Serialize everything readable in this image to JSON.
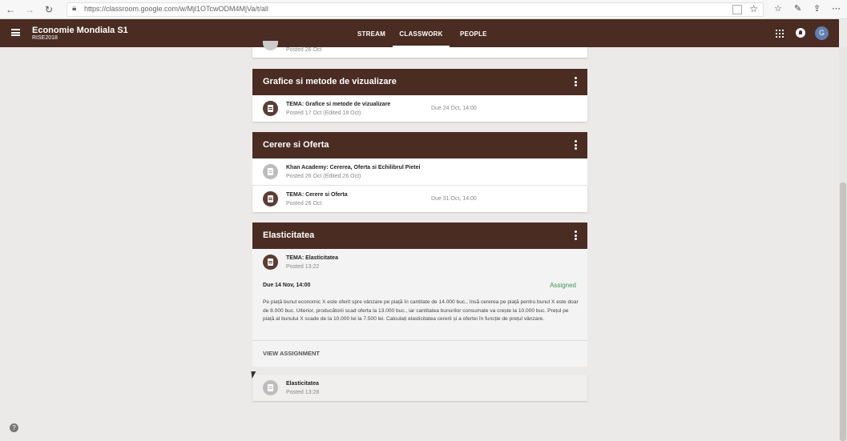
{
  "browser": {
    "url": "https://classroom.google.com/w/Mjl1OTcwODM4MjVa/t/all"
  },
  "app": {
    "class_title": "Economie Mondiala S1",
    "class_subtitle": "RISE2018",
    "tabs": [
      {
        "label": "STREAM"
      },
      {
        "label": "CLASSWORK"
      },
      {
        "label": "PEOPLE"
      }
    ],
    "avatar_letter": "G",
    "accent_color": "#4a2c23"
  },
  "top_partial": {
    "posted": "Posted 26 Oct"
  },
  "topics": [
    {
      "title": "Grafice si metode de vizualizare",
      "items": [
        {
          "title": "TEMA: Grafice si metode de vizualizare",
          "posted": "Posted 17 Oct (Edited 18 Oct)",
          "due": "Due 24 Oct, 14:00"
        }
      ]
    },
    {
      "title": "Cerere si Oferta",
      "items": [
        {
          "title": "Khan Academy: Cererea, Oferta si Echilibrul Pietei",
          "posted": "Posted 26 Oct (Edited 26 Oct)",
          "due": ""
        },
        {
          "title": "TEMA: Cerere si Oferta",
          "posted": "Posted 26 Oct",
          "due": "Due 31 Oct, 14:00"
        }
      ]
    },
    {
      "title": "Elasticitatea",
      "items": [
        {
          "title": "TEMA: Elasticitatea",
          "posted": "Posted 13:22",
          "due": ""
        }
      ],
      "expanded": {
        "due": "Due 14 Nov, 14:00",
        "status": "Assigned",
        "description": "Pe piață bunul economic X este oferit spre vânzare pe piață în cantitate de 14.000 buc., însă cererea pe piață pentru bunul X este doar de 8.000 buc. Ulterior, producătorii scad oferta la 13.000 buc., iar cantitatea bunurilor consumate va crește la 10.000 buc. Prețul pe piață al bunului X scade de la 10.000 lei la 7.500 lei. Calculați elasticitatea cererii și a ofertei în funcție de prețul vânzare.",
        "view_label": "VIEW ASSIGNMENT"
      }
    }
  ],
  "bottom_item": {
    "title": "Elasticitatea",
    "posted": "Posted 13:28"
  },
  "help_label": "?"
}
